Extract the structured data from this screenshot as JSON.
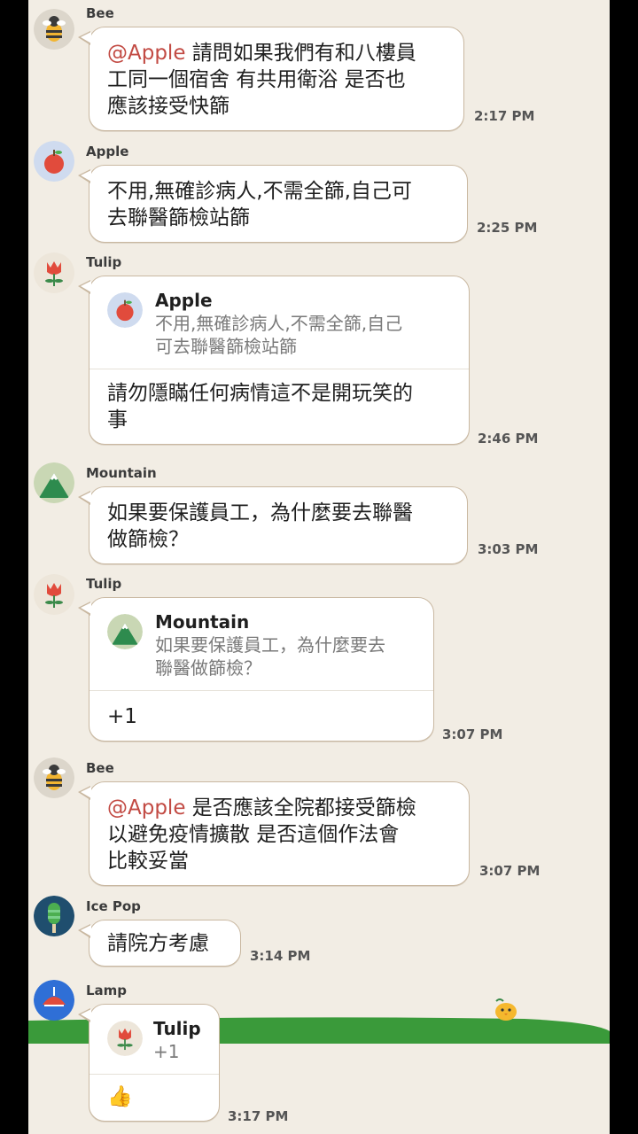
{
  "colors": {
    "background": "#f2ede4",
    "bubble_border": "#c9b8a1",
    "mention": "#c24a43"
  },
  "messages": [
    {
      "sender": "Bee",
      "avatar": "bee-icon",
      "mention": "@Apple",
      "text": " 請問如果我們有和八樓員\n工同一個宿舍 有共用衛浴 是否也\n應該接受快篩",
      "time": "2:17 PM"
    },
    {
      "sender": "Apple",
      "avatar": "apple-icon",
      "text": "不用,無確診病人,不需全篩,自己可\n去聯醫篩檢站篩",
      "time": "2:25 PM"
    },
    {
      "sender": "Tulip",
      "avatar": "tulip-icon",
      "quote": {
        "name": "Apple",
        "text": "不用,無確診病人,不需全篩,自己\n可去聯醫篩檢站篩"
      },
      "text": "請勿隱瞞任何病情這不是開玩笑的\n事",
      "time": "2:46 PM"
    },
    {
      "sender": "Mountain",
      "avatar": "mountain-icon",
      "text": "如果要保護員工，為什麼要去聯醫\n做篩檢？",
      "time": "3:03 PM"
    },
    {
      "sender": "Tulip",
      "avatar": "tulip-icon",
      "quote": {
        "name": "Mountain",
        "text": "如果要保護員工，為什麼要去\n聯醫做篩檢？"
      },
      "text": "+1",
      "time": "3:07 PM"
    },
    {
      "sender": "Bee",
      "avatar": "bee-icon",
      "mention": "@Apple",
      "text": " 是否應該全院都接受篩檢\n以避免疫情擴散 是否這個作法會\n比較妥當",
      "time": "3:07 PM"
    },
    {
      "sender": "Ice Pop",
      "avatar": "ice-pop-icon",
      "text": "請院方考慮",
      "time": "3:14 PM"
    },
    {
      "sender": "Lamp",
      "avatar": "lamp-icon",
      "quote": {
        "name": "Tulip",
        "text": "+1"
      },
      "text": "👍",
      "time": "3:17 PM"
    }
  ]
}
